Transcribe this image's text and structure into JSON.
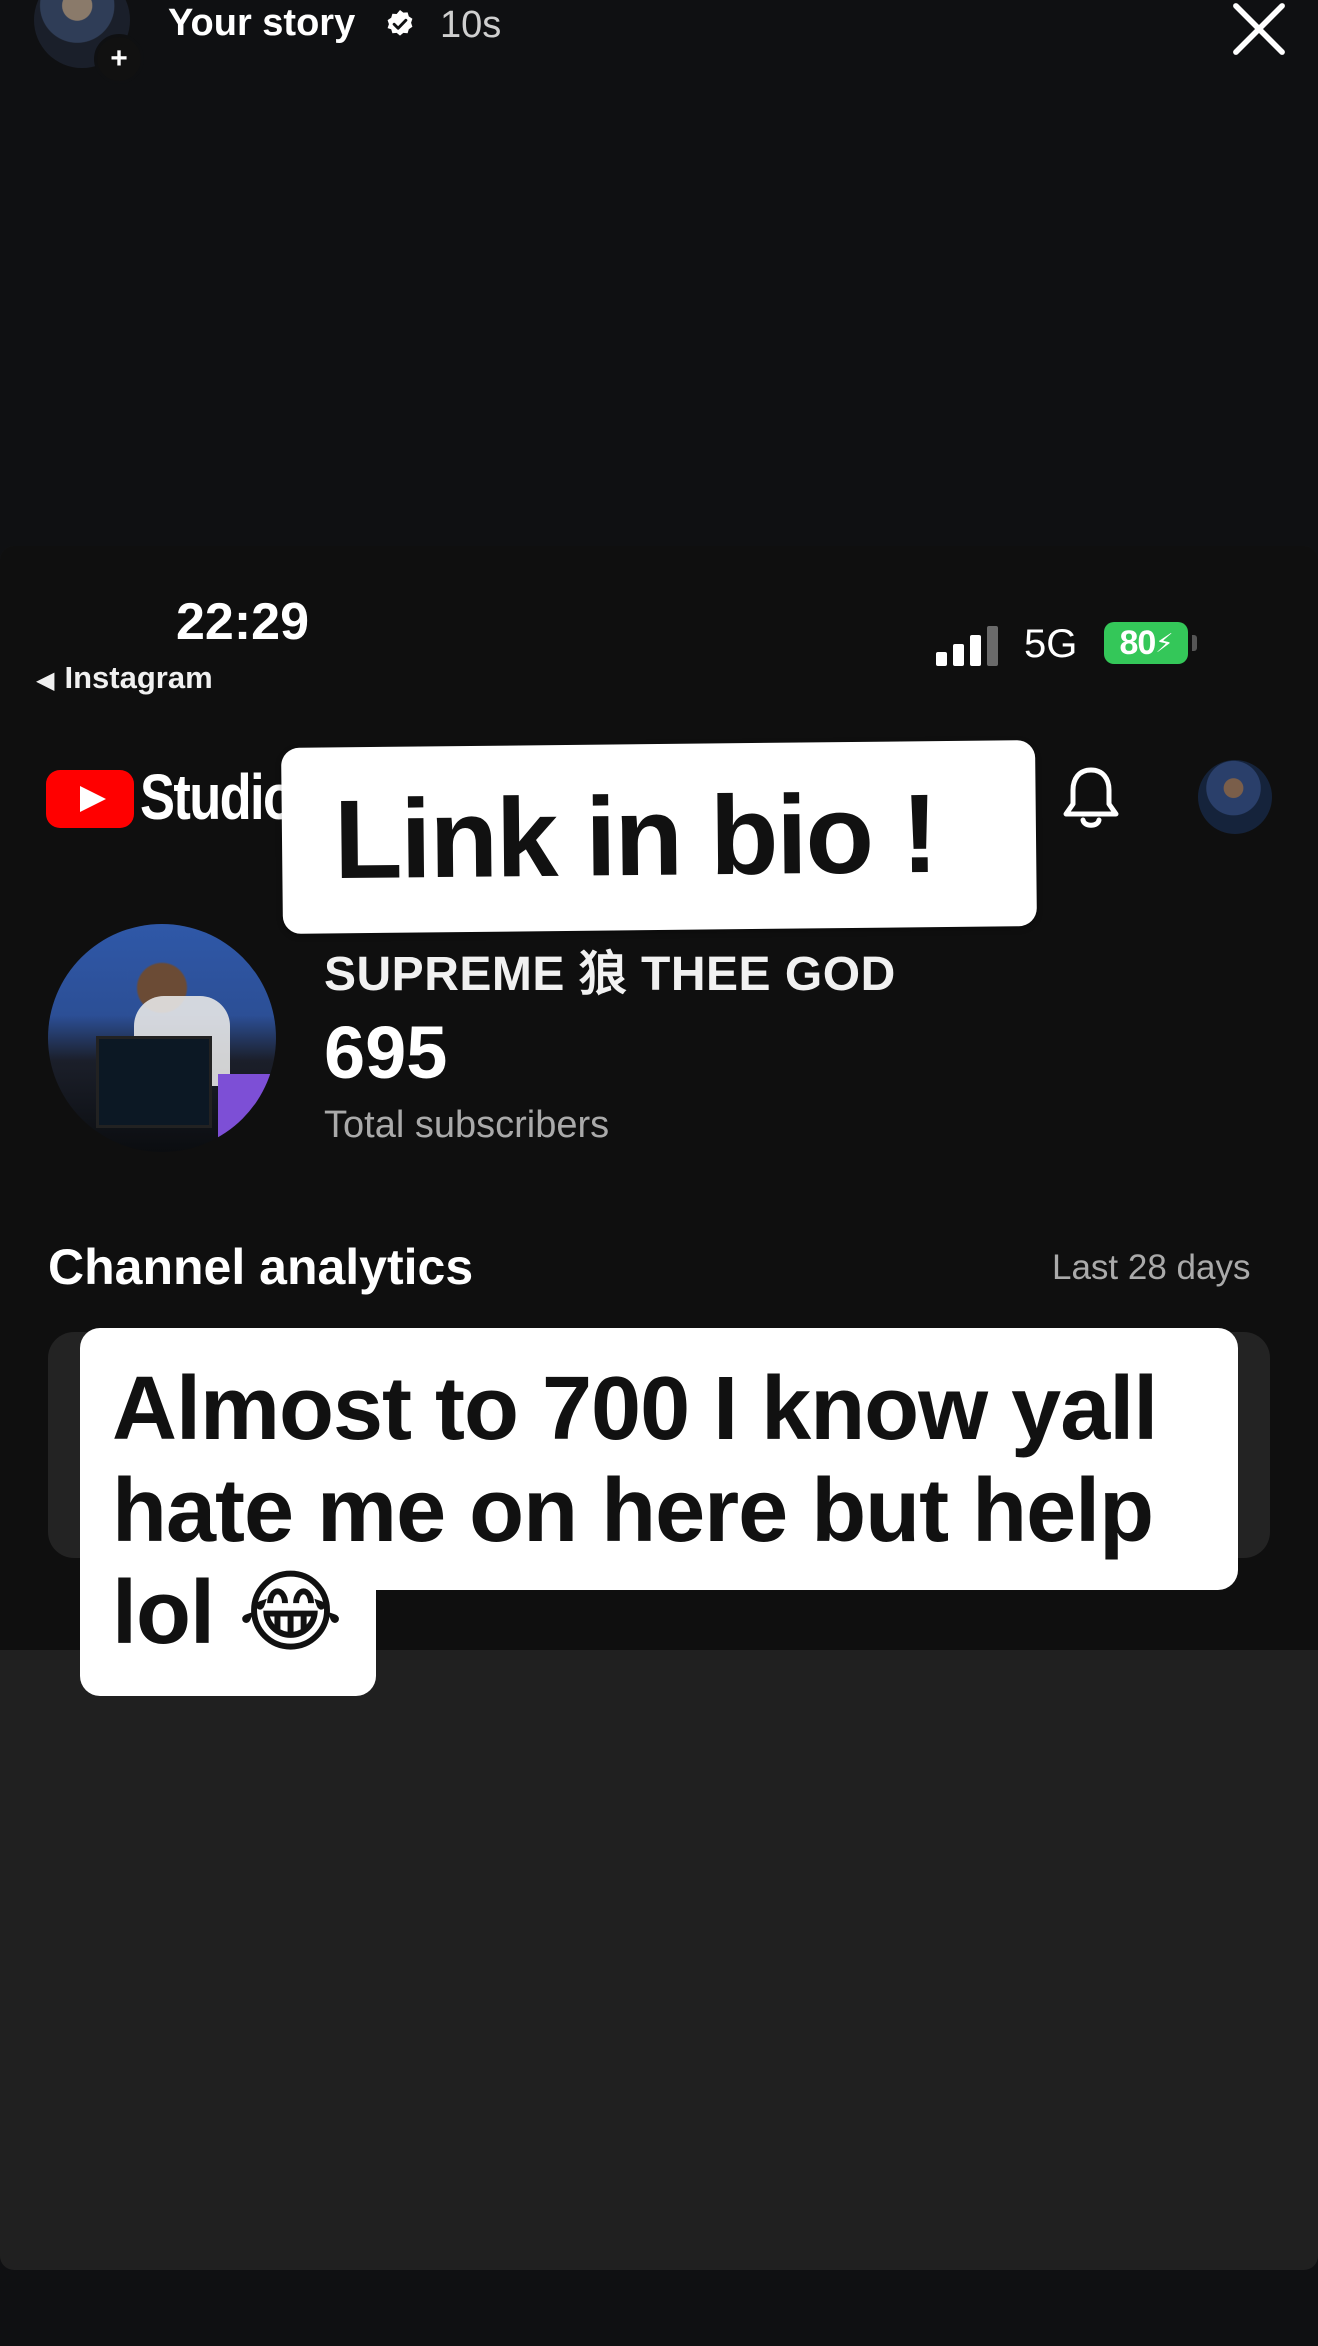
{
  "story": {
    "name": "Your story",
    "time": "10s",
    "plus": "+"
  },
  "phone": {
    "status_time": "22:29",
    "back_app": "Instagram",
    "network": "5G",
    "battery": "80"
  },
  "header": {
    "app_name": "Studio"
  },
  "channel": {
    "name": "SUPREME 狼 THEE GOD",
    "subscribers": "695",
    "subscribers_label": "Total subscribers"
  },
  "analytics": {
    "title": "Channel analytics",
    "range": "Last 28 days"
  },
  "overlays": {
    "link_sticker": "Link in bio !",
    "caption": "Almost to 700 I know yall hate me on here but help lol 😂"
  },
  "colors": {
    "youtube_red": "#ff0000",
    "battery_green": "#34c759"
  }
}
